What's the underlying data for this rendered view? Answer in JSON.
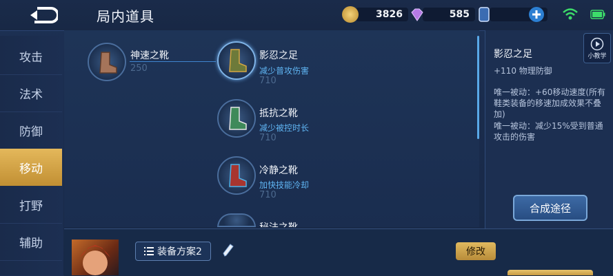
{
  "header": {
    "title": "局内道具"
  },
  "resources": {
    "gold": "3826",
    "gems": "585",
    "vouchers": "0"
  },
  "sidebar": {
    "items": [
      {
        "label": "攻击"
      },
      {
        "label": "法术"
      },
      {
        "label": "防御"
      },
      {
        "label": "移动",
        "active": true
      },
      {
        "label": "打野"
      },
      {
        "label": "辅助"
      }
    ]
  },
  "base_item": {
    "name": "神速之靴",
    "price": "250"
  },
  "upgrades": [
    {
      "name": "影忍之足",
      "desc": "减少普攻伤害",
      "price": "710"
    },
    {
      "name": "抵抗之靴",
      "desc": "减少被控时长",
      "price": "710"
    },
    {
      "name": "冷静之靴",
      "desc": "加快技能冷却",
      "price": "710"
    },
    {
      "name": "秘法之靴"
    }
  ],
  "detail": {
    "name": "影忍之足",
    "stat": "+110 物理防御",
    "passive1": "唯一被动：+60移动速度(所有鞋类装备的移速加成效果不叠加)",
    "passive2": "唯一被动：减少15%受到普通攻击的伤害",
    "tutorial_label": "小教学",
    "synth_label": "合成途径"
  },
  "bottom": {
    "scheme_label": "装备方案2",
    "edit_label": "修改"
  },
  "colors": {
    "accent_gold": "#d9a84a",
    "accent_blue": "#5fb4f2",
    "bg": "#1c2f51"
  }
}
